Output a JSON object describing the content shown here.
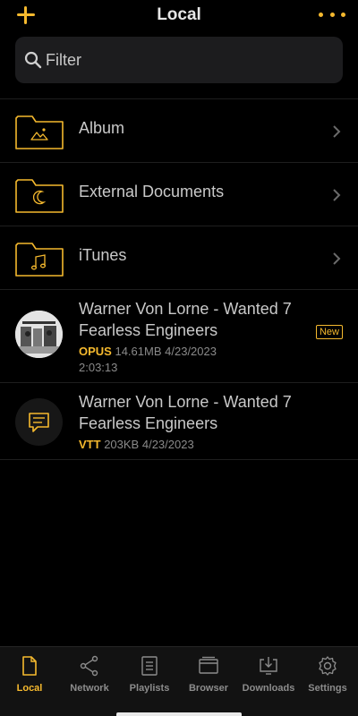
{
  "header": {
    "title": "Local"
  },
  "search": {
    "placeholder": "Filter"
  },
  "folders": [
    {
      "label": "Album",
      "icon": "image-icon"
    },
    {
      "label": "External Documents",
      "icon": "moon-icon"
    },
    {
      "label": "iTunes",
      "icon": "music-note-icon"
    }
  ],
  "files": [
    {
      "title": "Warner Von Lorne - Wanted 7 Fearless Engineers",
      "format": "OPUS",
      "size": "14.61MB",
      "date": "4/23/2023",
      "duration": "2:03:13",
      "badge": "New"
    },
    {
      "title": "Warner Von Lorne - Wanted 7 Fearless Engineers",
      "format": "VTT",
      "size": "203KB",
      "date": "4/23/2023"
    }
  ],
  "tabs": [
    {
      "label": "Local",
      "icon": "document-icon",
      "active": true
    },
    {
      "label": "Network",
      "icon": "share-icon"
    },
    {
      "label": "Playlists",
      "icon": "list-icon"
    },
    {
      "label": "Browser",
      "icon": "browser-icon"
    },
    {
      "label": "Downloads",
      "icon": "download-icon"
    },
    {
      "label": "Settings",
      "icon": "gear-icon"
    }
  ],
  "colors": {
    "accent": "#f5b92e",
    "background": "#000000",
    "text": "#c9c9c9",
    "secondary": "#8a8a8a"
  }
}
